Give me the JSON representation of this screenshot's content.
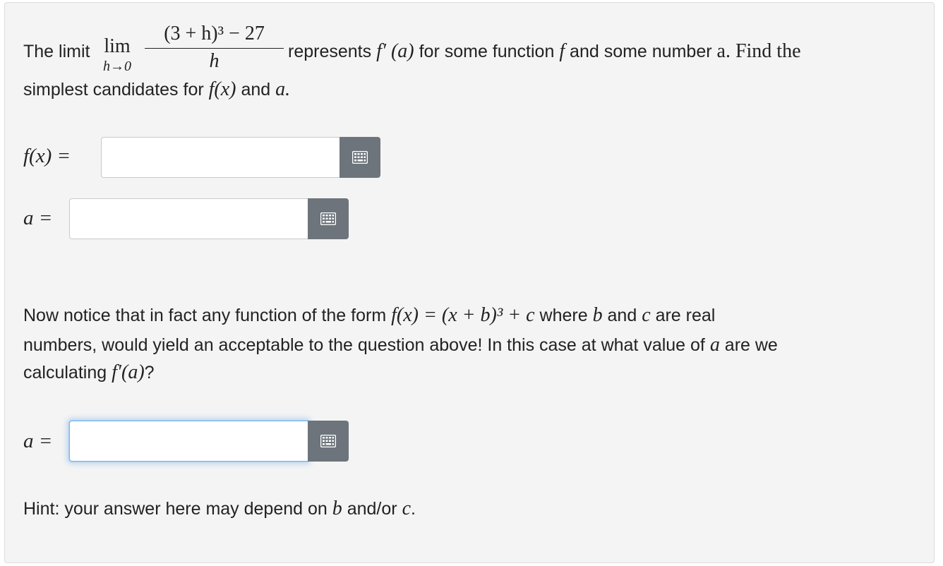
{
  "q1": {
    "the_limit": "The limit",
    "lim": "lim",
    "lim_sub": "h→0",
    "numerator": "(3 + h)³ − 27",
    "denominator": "h",
    "represents": "represents",
    "fprime_a": "f′ (a)",
    "for_some_function": "for some function",
    "f": "f",
    "and_some_number": "and some number",
    "a_period": "a. Find the",
    "simplest": "simplest candidates for",
    "fx": "f(x)",
    "and": "and",
    "a_end": "a."
  },
  "fields": {
    "fx_label": "f(x) =",
    "a_label": "a =",
    "a2_label": "a ="
  },
  "q2": {
    "line1_a": "Now notice that in fact any function of the form",
    "line1_math": "f(x) = (x + b)³ + c",
    "line1_b": "where",
    "b": "b",
    "and": "and",
    "c": "c",
    "are_real": "are real",
    "line2_a": "numbers, would yield an acceptable to the question above! In this case at what value of",
    "a": "a",
    "are_we": "are we",
    "line3_a": "calculating",
    "line3_math": "f′(a)",
    "q_mark": "?"
  },
  "hint": {
    "text_a": "Hint: your answer here may depend on",
    "b": "b",
    "and_or": "and/or",
    "c": "c",
    "period": "."
  },
  "icons": {
    "keypad": "keypad-grid-icon"
  },
  "colors": {
    "button": "#6d747b",
    "focus": "#7fb4e8",
    "card": "#f4f4f4"
  }
}
